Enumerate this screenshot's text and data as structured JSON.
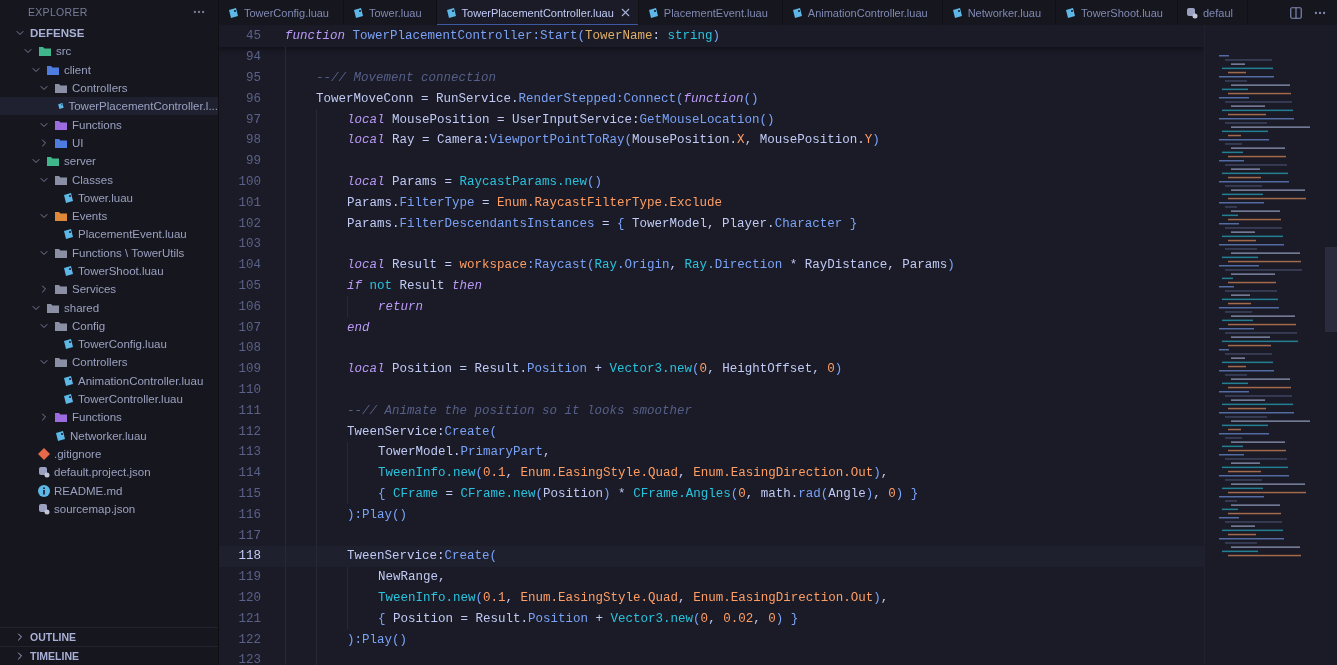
{
  "sidebar": {
    "title": "EXPLORER",
    "root": {
      "label": "DEFENSE",
      "expanded": true,
      "children": [
        {
          "label": "src",
          "kind": "folder",
          "color": "#3fb68b",
          "expanded": true,
          "selected": false,
          "children": [
            {
              "label": "client",
              "kind": "folder",
              "color": "#4f7ce0",
              "expanded": true,
              "selected": false,
              "children": [
                {
                  "label": "Controllers",
                  "kind": "folder",
                  "color": "#8a8fa3",
                  "expanded": true,
                  "selected": false,
                  "children": [
                    {
                      "label": "TowerPlacementController.l...",
                      "kind": "luau",
                      "selected": true
                    }
                  ]
                },
                {
                  "label": "Functions",
                  "kind": "folder",
                  "color": "#9b6bdf",
                  "expanded": true,
                  "selected": false
                },
                {
                  "label": "UI",
                  "kind": "folder",
                  "color": "#4f7ce0",
                  "expanded": false,
                  "selected": false
                }
              ]
            },
            {
              "label": "server",
              "kind": "folder",
              "color": "#3fb68b",
              "expanded": true,
              "selected": false,
              "children": [
                {
                  "label": "Classes",
                  "kind": "folder",
                  "color": "#8a8fa3",
                  "expanded": true,
                  "selected": false,
                  "children": [
                    {
                      "label": "Tower.luau",
                      "kind": "luau",
                      "selected": false
                    }
                  ]
                },
                {
                  "label": "Events",
                  "kind": "folder",
                  "color": "#e0883a",
                  "expanded": true,
                  "selected": false,
                  "children": [
                    {
                      "label": "PlacementEvent.luau",
                      "kind": "luau",
                      "selected": false
                    }
                  ]
                },
                {
                  "label": "Functions \\ TowerUtils",
                  "kind": "folder",
                  "color": "#8a8fa3",
                  "expanded": true,
                  "selected": false,
                  "children": [
                    {
                      "label": "TowerShoot.luau",
                      "kind": "luau",
                      "selected": false
                    }
                  ]
                },
                {
                  "label": "Services",
                  "kind": "folder",
                  "color": "#8a8fa3",
                  "expanded": false,
                  "selected": false
                }
              ]
            },
            {
              "label": "shared",
              "kind": "folder",
              "color": "#8a8fa3",
              "expanded": true,
              "selected": false,
              "children": [
                {
                  "label": "Config",
                  "kind": "folder",
                  "color": "#8a8fa3",
                  "expanded": true,
                  "selected": false,
                  "children": [
                    {
                      "label": "TowerConfig.luau",
                      "kind": "luau",
                      "selected": false
                    }
                  ]
                },
                {
                  "label": "Controllers",
                  "kind": "folder",
                  "color": "#8a8fa3",
                  "expanded": true,
                  "selected": false,
                  "children": [
                    {
                      "label": "AnimationController.luau",
                      "kind": "luau",
                      "selected": false
                    },
                    {
                      "label": "TowerController.luau",
                      "kind": "luau",
                      "selected": false
                    }
                  ]
                },
                {
                  "label": "Functions",
                  "kind": "folder",
                  "color": "#9b6bdf",
                  "expanded": false,
                  "selected": false
                },
                {
                  "label": "Networker.luau",
                  "kind": "luau",
                  "selected": false
                }
              ]
            }
          ]
        },
        {
          "label": ".gitignore",
          "kind": "git",
          "selected": false
        },
        {
          "label": "default.project.json",
          "kind": "settings",
          "selected": false
        },
        {
          "label": "README.md",
          "kind": "info",
          "selected": false
        },
        {
          "label": "sourcemap.json",
          "kind": "settings",
          "selected": false
        }
      ]
    },
    "sections": [
      {
        "label": "OUTLINE",
        "expanded": false
      },
      {
        "label": "TIMELINE",
        "expanded": false
      }
    ]
  },
  "tabs": [
    {
      "label": "TowerConfig.luau",
      "kind": "luau",
      "selected": false
    },
    {
      "label": "Tower.luau",
      "kind": "luau",
      "selected": false
    },
    {
      "label": "TowerPlacementController.luau",
      "kind": "luau",
      "selected": true
    },
    {
      "label": "PlacementEvent.luau",
      "kind": "luau",
      "selected": false
    },
    {
      "label": "AnimationController.luau",
      "kind": "luau",
      "selected": false
    },
    {
      "label": "Networker.luau",
      "kind": "luau",
      "selected": false
    },
    {
      "label": "TowerShoot.luau",
      "kind": "luau",
      "selected": false
    },
    {
      "label": "defaul",
      "kind": "settings",
      "selected": false
    }
  ],
  "editor": {
    "lines": [
      {
        "number": "45",
        "selected": false,
        "tokens": [
          {
            "kind": "kw",
            "text": "function "
          },
          {
            "kind": "fn",
            "text": "TowerPlacementController:Start("
          },
          {
            "kind": "prm",
            "text": "TowerName"
          },
          {
            "kind": "id",
            "text": ": "
          },
          {
            "kind": "cls",
            "text": "string"
          },
          {
            "kind": "fn",
            "text": ")"
          }
        ],
        "children": [
          {
            "number": "94",
            "selected": false
          },
          {
            "number": "95",
            "selected": false,
            "tokens": [
              {
                "kind": "cm",
                "text": "--// Movement connection"
              }
            ]
          },
          {
            "number": "96",
            "selected": false,
            "tokens": [
              {
                "kind": "id",
                "text": "TowerMoveConn = RunService."
              },
              {
                "kind": "fn",
                "text": "RenderStepped:Connect("
              },
              {
                "kind": "kw",
                "text": "function"
              },
              {
                "kind": "fn",
                "text": "()"
              }
            ],
            "children": [
              {
                "number": "97",
                "selected": false,
                "tokens": [
                  {
                    "kind": "kw",
                    "text": "local "
                  },
                  {
                    "kind": "id",
                    "text": "MousePosition = UserInputService:"
                  },
                  {
                    "kind": "fn",
                    "text": "GetMouseLocation()"
                  }
                ]
              },
              {
                "number": "98",
                "selected": false,
                "tokens": [
                  {
                    "kind": "kw",
                    "text": "local "
                  },
                  {
                    "kind": "id",
                    "text": "Ray = Camera:"
                  },
                  {
                    "kind": "fn",
                    "text": "ViewportPointToRay("
                  },
                  {
                    "kind": "id",
                    "text": "MousePosition."
                  },
                  {
                    "kind": "num",
                    "text": "X"
                  },
                  {
                    "kind": "id",
                    "text": ", MousePosition."
                  },
                  {
                    "kind": "num",
                    "text": "Y"
                  },
                  {
                    "kind": "fn",
                    "text": ")"
                  }
                ]
              },
              {
                "number": "99",
                "selected": false
              },
              {
                "number": "100",
                "selected": false,
                "tokens": [
                  {
                    "kind": "kw",
                    "text": "local "
                  },
                  {
                    "kind": "id",
                    "text": "Params = "
                  },
                  {
                    "kind": "cls",
                    "text": "RaycastParams.new"
                  },
                  {
                    "kind": "fn",
                    "text": "()"
                  }
                ]
              },
              {
                "number": "101",
                "selected": false,
                "tokens": [
                  {
                    "kind": "id",
                    "text": "Params."
                  },
                  {
                    "kind": "fn",
                    "text": "FilterType"
                  },
                  {
                    "kind": "id",
                    "text": " = "
                  },
                  {
                    "kind": "num",
                    "text": "Enum.RaycastFilterType.Exclude"
                  }
                ]
              },
              {
                "number": "102",
                "selected": false,
                "tokens": [
                  {
                    "kind": "id",
                    "text": "Params."
                  },
                  {
                    "kind": "fn",
                    "text": "FilterDescendantsInstances"
                  },
                  {
                    "kind": "id",
                    "text": " = "
                  },
                  {
                    "kind": "fn",
                    "text": "{ "
                  },
                  {
                    "kind": "id",
                    "text": "TowerModel, Player."
                  },
                  {
                    "kind": "fn",
                    "text": "Character }"
                  }
                ]
              },
              {
                "number": "103",
                "selected": false
              },
              {
                "number": "104",
                "selected": false,
                "tokens": [
                  {
                    "kind": "kw",
                    "text": "local "
                  },
                  {
                    "kind": "id",
                    "text": "Result = "
                  },
                  {
                    "kind": "num",
                    "text": "workspace"
                  },
                  {
                    "kind": "fn",
                    "text": ":Raycast("
                  },
                  {
                    "kind": "cls",
                    "text": "Ray"
                  },
                  {
                    "kind": "fn",
                    "text": ".Origin"
                  },
                  {
                    "kind": "id",
                    "text": ", "
                  },
                  {
                    "kind": "cls",
                    "text": "Ray"
                  },
                  {
                    "kind": "fn",
                    "text": ".Direction"
                  },
                  {
                    "kind": "id",
                    "text": " * RayDistance, Params"
                  },
                  {
                    "kind": "fn",
                    "text": ")"
                  }
                ]
              },
              {
                "number": "105",
                "selected": false,
                "tokens": [
                  {
                    "kind": "kw",
                    "text": "if "
                  },
                  {
                    "kind": "cls",
                    "text": "not "
                  },
                  {
                    "kind": "id",
                    "text": "Result "
                  },
                  {
                    "kind": "kw",
                    "text": "then"
                  }
                ],
                "children": [
                  {
                    "number": "106",
                    "selected": false,
                    "tokens": [
                      {
                        "kind": "kw",
                        "text": "return"
                      }
                    ]
                  }
                ]
              },
              {
                "number": "107",
                "selected": false,
                "tokens": [
                  {
                    "kind": "kw",
                    "text": "end"
                  }
                ]
              },
              {
                "number": "108",
                "selected": false
              },
              {
                "number": "109",
                "selected": false,
                "tokens": [
                  {
                    "kind": "kw",
                    "text": "local "
                  },
                  {
                    "kind": "id",
                    "text": "Position = Result."
                  },
                  {
                    "kind": "fn",
                    "text": "Position"
                  },
                  {
                    "kind": "id",
                    "text": " + "
                  },
                  {
                    "kind": "cls",
                    "text": "Vector3.new"
                  },
                  {
                    "kind": "fn",
                    "text": "("
                  },
                  {
                    "kind": "num",
                    "text": "0"
                  },
                  {
                    "kind": "id",
                    "text": ", HeightOffset, "
                  },
                  {
                    "kind": "num",
                    "text": "0"
                  },
                  {
                    "kind": "fn",
                    "text": ")"
                  }
                ]
              },
              {
                "number": "110",
                "selected": false
              },
              {
                "number": "111",
                "selected": false,
                "tokens": [
                  {
                    "kind": "cm",
                    "text": "--// Animate the position so it looks smoother"
                  }
                ]
              },
              {
                "number": "112",
                "selected": false,
                "tokens": [
                  {
                    "kind": "id",
                    "text": "TweenService:"
                  },
                  {
                    "kind": "fn",
                    "text": "Create("
                  }
                ],
                "children": [
                  {
                    "number": "113",
                    "selected": false,
                    "tokens": [
                      {
                        "kind": "id",
                        "text": "TowerModel."
                      },
                      {
                        "kind": "fn",
                        "text": "PrimaryPart"
                      },
                      {
                        "kind": "id",
                        "text": ","
                      }
                    ]
                  },
                  {
                    "number": "114",
                    "selected": false,
                    "tokens": [
                      {
                        "kind": "cls",
                        "text": "TweenInfo.new"
                      },
                      {
                        "kind": "fn",
                        "text": "("
                      },
                      {
                        "kind": "num",
                        "text": "0.1"
                      },
                      {
                        "kind": "id",
                        "text": ", "
                      },
                      {
                        "kind": "num",
                        "text": "Enum.EasingStyle.Quad"
                      },
                      {
                        "kind": "id",
                        "text": ", "
                      },
                      {
                        "kind": "num",
                        "text": "Enum.EasingDirection.Out"
                      },
                      {
                        "kind": "fn",
                        "text": ")"
                      },
                      {
                        "kind": "id",
                        "text": ","
                      }
                    ]
                  },
                  {
                    "number": "115",
                    "selected": false,
                    "tokens": [
                      {
                        "kind": "fn",
                        "text": "{ "
                      },
                      {
                        "kind": "cls",
                        "text": "CFrame"
                      },
                      {
                        "kind": "id",
                        "text": " = "
                      },
                      {
                        "kind": "cls",
                        "text": "CFrame.new"
                      },
                      {
                        "kind": "fn",
                        "text": "("
                      },
                      {
                        "kind": "id",
                        "text": "Position"
                      },
                      {
                        "kind": "fn",
                        "text": ")"
                      },
                      {
                        "kind": "id",
                        "text": " * "
                      },
                      {
                        "kind": "cls",
                        "text": "CFrame.Angles"
                      },
                      {
                        "kind": "fn",
                        "text": "("
                      },
                      {
                        "kind": "num",
                        "text": "0"
                      },
                      {
                        "kind": "id",
                        "text": ", math."
                      },
                      {
                        "kind": "fn",
                        "text": "rad("
                      },
                      {
                        "kind": "id",
                        "text": "Angle"
                      },
                      {
                        "kind": "fn",
                        "text": ")"
                      },
                      {
                        "kind": "id",
                        "text": ", "
                      },
                      {
                        "kind": "num",
                        "text": "0"
                      },
                      {
                        "kind": "fn",
                        "text": ") }"
                      }
                    ]
                  }
                ]
              },
              {
                "number": "116",
                "selected": false,
                "tokens": [
                  {
                    "kind": "fn",
                    "text": "):Play()"
                  }
                ]
              },
              {
                "number": "117",
                "selected": false
              },
              {
                "number": "118",
                "selected": true,
                "tokens": [
                  {
                    "kind": "id",
                    "text": "TweenService:"
                  },
                  {
                    "kind": "fn",
                    "text": "Create("
                  }
                ],
                "children": [
                  {
                    "number": "119",
                    "selected": false,
                    "tokens": [
                      {
                        "kind": "id",
                        "text": "NewRange,"
                      }
                    ]
                  },
                  {
                    "number": "120",
                    "selected": false,
                    "tokens": [
                      {
                        "kind": "cls",
                        "text": "TweenInfo.new"
                      },
                      {
                        "kind": "fn",
                        "text": "("
                      },
                      {
                        "kind": "num",
                        "text": "0.1"
                      },
                      {
                        "kind": "id",
                        "text": ", "
                      },
                      {
                        "kind": "num",
                        "text": "Enum.EasingStyle.Quad"
                      },
                      {
                        "kind": "id",
                        "text": ", "
                      },
                      {
                        "kind": "num",
                        "text": "Enum.EasingDirection.Out"
                      },
                      {
                        "kind": "fn",
                        "text": ")"
                      },
                      {
                        "kind": "id",
                        "text": ","
                      }
                    ]
                  },
                  {
                    "number": "121",
                    "selected": false,
                    "tokens": [
                      {
                        "kind": "fn",
                        "text": "{ "
                      },
                      {
                        "kind": "id",
                        "text": "Position = Result."
                      },
                      {
                        "kind": "fn",
                        "text": "Position"
                      },
                      {
                        "kind": "id",
                        "text": " + "
                      },
                      {
                        "kind": "cls",
                        "text": "Vector3.new"
                      },
                      {
                        "kind": "fn",
                        "text": "("
                      },
                      {
                        "kind": "num",
                        "text": "0"
                      },
                      {
                        "kind": "id",
                        "text": ", "
                      },
                      {
                        "kind": "num",
                        "text": "0.02"
                      },
                      {
                        "kind": "id",
                        "text": ", "
                      },
                      {
                        "kind": "num",
                        "text": "0"
                      },
                      {
                        "kind": "fn",
                        "text": ") }"
                      }
                    ]
                  }
                ]
              },
              {
                "number": "122",
                "selected": false,
                "tokens": [
                  {
                    "kind": "fn",
                    "text": "):Play()"
                  }
                ]
              },
              {
                "number": "123",
                "selected": false
              }
            ]
          }
        ]
      }
    ]
  }
}
